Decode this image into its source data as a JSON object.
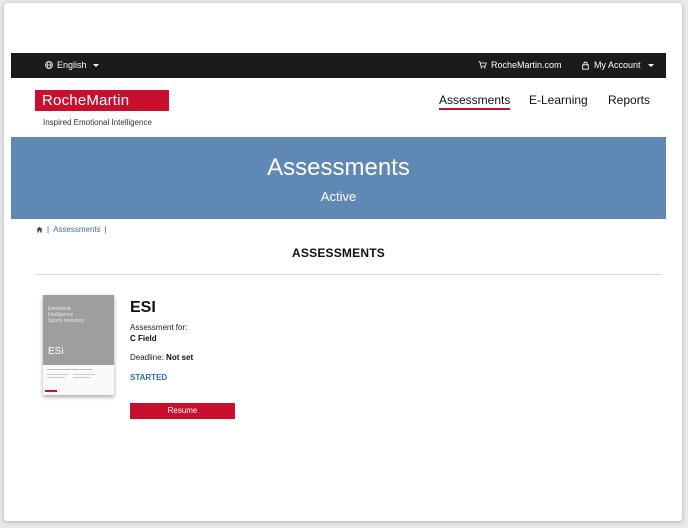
{
  "topbar": {
    "language": "English",
    "site_link": "RocheMartin.com",
    "account": "My Account"
  },
  "header": {
    "logo": "RocheMartin",
    "tagline": "Inspired Emotional Intelligence",
    "nav": [
      "Assessments",
      "E-Learning",
      "Reports"
    ],
    "active_nav": "Assessments"
  },
  "banner": {
    "title": "Assessments",
    "subtitle": "Active"
  },
  "breadcrumb": {
    "items": [
      "Assessments"
    ]
  },
  "page": {
    "heading": "ASSESSMENTS"
  },
  "assessment": {
    "title": "ESI",
    "for_label": "Assessment for:",
    "for_name": "C Field",
    "deadline_label": "Deadline:",
    "deadline_value": "Not set",
    "status": "STARTED",
    "action": "Resume",
    "cover": {
      "lines": [
        "Emotional",
        "Intelligence",
        "Sports Inventory"
      ],
      "code": "ESi"
    }
  },
  "colors": {
    "brand_red": "#c8102e",
    "banner_blue": "#6088b4",
    "link_blue": "#3a6ea8",
    "topbar": "#1b1b1b"
  },
  "icons": [
    "globe-icon",
    "cart-icon",
    "lock-icon",
    "home-icon"
  ]
}
